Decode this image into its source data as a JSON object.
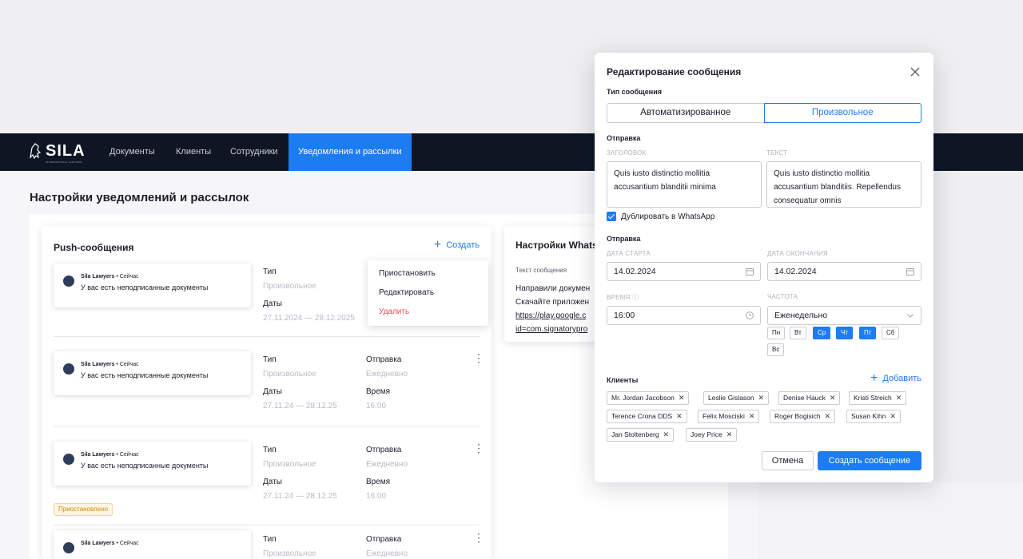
{
  "nav": {
    "logo_text": "SILA",
    "logo_sub": "INTERNATIONAL LAWYERS",
    "items": [
      "Документы",
      "Клиенты",
      "Сотрудники",
      "Уведомления и рассылки"
    ],
    "active_index": 3
  },
  "page": {
    "title": "Настройки уведомлений и рассылок"
  },
  "push": {
    "title": "Push-сообщения",
    "create_label": "Создать",
    "items": [
      {
        "sender": "Sila Lawyers",
        "time": "Сейчас",
        "text": "У вас есть неподписанные документы",
        "type_label": "Тип",
        "type_value": "Произвольное",
        "dates_label": "Даты",
        "dates_value": "27.11.2024 — 28.12.2025",
        "send_label": "",
        "send_value": "",
        "time_label": "",
        "time_value": ""
      },
      {
        "sender": "Sila Lawyers",
        "time": "Сейчас",
        "text": "У вас есть неподписанные документы",
        "type_label": "Тип",
        "type_value": "Произвольное",
        "dates_label": "Даты",
        "dates_value": "27.11.24 — 28.12.25",
        "send_label": "Отправка",
        "send_value": "Ежедневно",
        "time_label": "Время",
        "time_value": "16:00"
      },
      {
        "sender": "Sila Lawyers",
        "time": "Сейчас",
        "text": "У вас есть неподписанные документы",
        "type_label": "Тип",
        "type_value": "Произвольное",
        "dates_label": "Даты",
        "dates_value": "27.11.24 — 28.12.25",
        "send_label": "Отправка",
        "send_value": "Ежедневно",
        "time_label": "Время",
        "time_value": "16:00",
        "badge": "Приостановлено"
      },
      {
        "sender": "Sila Lawyers",
        "time": "Сейчас",
        "text": "",
        "type_label": "Тип",
        "type_value": "Произвольное",
        "send_label": "Отправка",
        "send_value": "Ежедневно"
      }
    ],
    "menu": [
      "Приостановить",
      "Редактировать",
      "Удалить"
    ]
  },
  "whatsapp": {
    "title": "Настройки WhatsApp",
    "text_label": "Текст сообщения",
    "lines": [
      "Направили докумен",
      "Скачайте приложен",
      "https://play.google.c",
      "id=com.signatorypro"
    ]
  },
  "modal": {
    "title": "Редактирование сообщения",
    "type_section": "Тип сообщения",
    "type_options": [
      "Автоматизированное",
      "Произвольное"
    ],
    "selected_type": 1,
    "send_section_1": "Отправка",
    "header_label": "ЗАГОЛОВОК",
    "header_value": "Quis iusto distinctio mollitia accusantium blanditii minima",
    "text_label": "ТЕКСТ",
    "text_value": "Quis iusto distinctio mollitia accusantium blanditiis. Repellendus consequatur omnis",
    "whatsapp_checkbox": "Дублировать в WhatsApp",
    "whatsapp_checked": true,
    "send_section_2": "Отправка",
    "start_label": "ДАТА СТАРТА",
    "start_value": "14.02.2024",
    "end_label": "ДАТА ОКОНЧАНИЯ",
    "end_value": "14.02.2024",
    "time_label": "ВРЕМЯ",
    "time_value": "16:00",
    "freq_label": "ЧАСТОТА",
    "freq_value": "Еженедельно",
    "days": [
      {
        "label": "Пн",
        "on": false
      },
      {
        "label": "Вт",
        "on": false
      },
      {
        "label": "Ср",
        "on": true
      },
      {
        "label": "Чт",
        "on": true
      },
      {
        "label": "Пт",
        "on": true
      },
      {
        "label": "Сб",
        "on": false
      },
      {
        "label": "Вс",
        "on": false
      }
    ],
    "clients_label": "Клиенты",
    "add_label": "Добавить",
    "clients": [
      "Mr. Jordan Jacobson",
      "Leslie Gislason",
      "Denise Hauck",
      "Kristi Streich",
      "Terence Crona DDS",
      "Felix Mosciski",
      "Roger Bogisich",
      "Susan Kihn",
      "Jan Stoltenberg",
      "Joey Price"
    ],
    "cancel_label": "Отмена",
    "submit_label": "Создать сообщение"
  },
  "colors": {
    "accent": "#1e7cf2",
    "nav_bg": "#0e1624",
    "danger": "#e55353",
    "warning": "#c98a16"
  }
}
